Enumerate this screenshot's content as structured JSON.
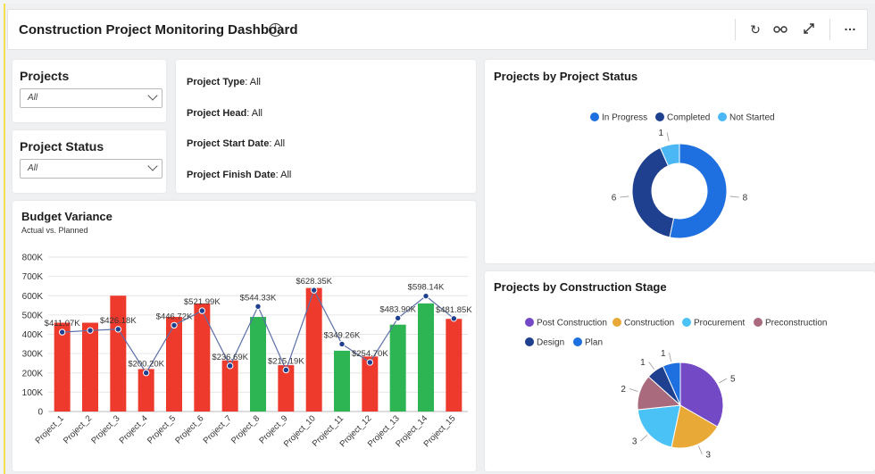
{
  "header": {
    "title": "Construction Project Monitoring Dashboard",
    "icons": [
      "refresh-icon",
      "glasses-icon",
      "expand-icon",
      "more-icon"
    ]
  },
  "filters": {
    "projects": {
      "label": "Projects",
      "value": "All"
    },
    "status": {
      "label": "Project Status",
      "value": "All"
    }
  },
  "info": [
    {
      "label": "Project Type",
      "value": "All"
    },
    {
      "label": "Project Head",
      "value": "All"
    },
    {
      "label": "Project Start Date",
      "value": "All"
    },
    {
      "label": "Project Finish Date",
      "value": "All"
    }
  ],
  "budget": {
    "title": "Budget Variance",
    "subtitle": "Actual vs. Planned"
  },
  "status_chart": {
    "title": "Projects by Project Status"
  },
  "stage_chart": {
    "title": "Projects by Construction Stage"
  },
  "chart_data": [
    {
      "type": "bar",
      "title": "Budget Variance",
      "subtitle": "Actual vs. Planned",
      "categories": [
        "Project_1",
        "Project_2",
        "Project_3",
        "Project_4",
        "Project_5",
        "Project_6",
        "Project_7",
        "Project_8",
        "Project_9",
        "Project_10",
        "Project_11",
        "Project_12",
        "Project_13",
        "Project_14",
        "Project_15"
      ],
      "series": [
        {
          "values": [
            460000,
            460000,
            600000,
            220000,
            490000,
            560000,
            265000,
            490000,
            240000,
            640000,
            315000,
            285000,
            450000,
            560000,
            480000
          ],
          "colors": [
            "#ee3a2c",
            "#ee3a2c",
            "#ee3a2c",
            "#ee3a2c",
            "#ee3a2c",
            "#ee3a2c",
            "#ee3a2c",
            "#2db553",
            "#ee3a2c",
            "#ee3a2c",
            "#2db553",
            "#ee3a2c",
            "#2db553",
            "#2db553",
            "#ee3a2c"
          ]
        },
        {
          "type": "line",
          "values": [
            411070,
            420000,
            426180,
            200200,
            446720,
            521990,
            236690,
            544330,
            215190,
            628350,
            349260,
            254700,
            483900,
            598140,
            481850
          ]
        }
      ],
      "data_labels": [
        "$411.07K",
        "",
        "$426.18K",
        "$200.20K",
        "$446.72K",
        "$521.99K",
        "$236.69K",
        "$544.33K",
        "$215.19K",
        "$628.35K",
        "$349.26K",
        "$254.70K",
        "$483.90K",
        "$598.14K",
        "$481.85K"
      ],
      "yticks": [
        "0",
        "100K",
        "200K",
        "300K",
        "400K",
        "500K",
        "600K",
        "700K",
        "800K"
      ],
      "ylim": [
        0,
        800000
      ],
      "grid": true
    },
    {
      "type": "pie",
      "variant": "donut",
      "title": "Projects by Project Status",
      "categories": [
        "In Progress",
        "Completed",
        "Not Started"
      ],
      "values": [
        8,
        6,
        1
      ],
      "colors": [
        "#1e6fe0",
        "#1f3f8f",
        "#4bb8f5"
      ],
      "legend": "top"
    },
    {
      "type": "pie",
      "title": "Projects by Construction Stage",
      "categories": [
        "Post Construction",
        "Construction",
        "Procurement",
        "Preconstruction",
        "Design",
        "Plan"
      ],
      "values": [
        5,
        3,
        3,
        2,
        1,
        1
      ],
      "colors": [
        "#7449c6",
        "#e8a936",
        "#4bc2f5",
        "#a86a7c",
        "#1f3f8f",
        "#1e6fe0"
      ],
      "legend": "top"
    }
  ]
}
